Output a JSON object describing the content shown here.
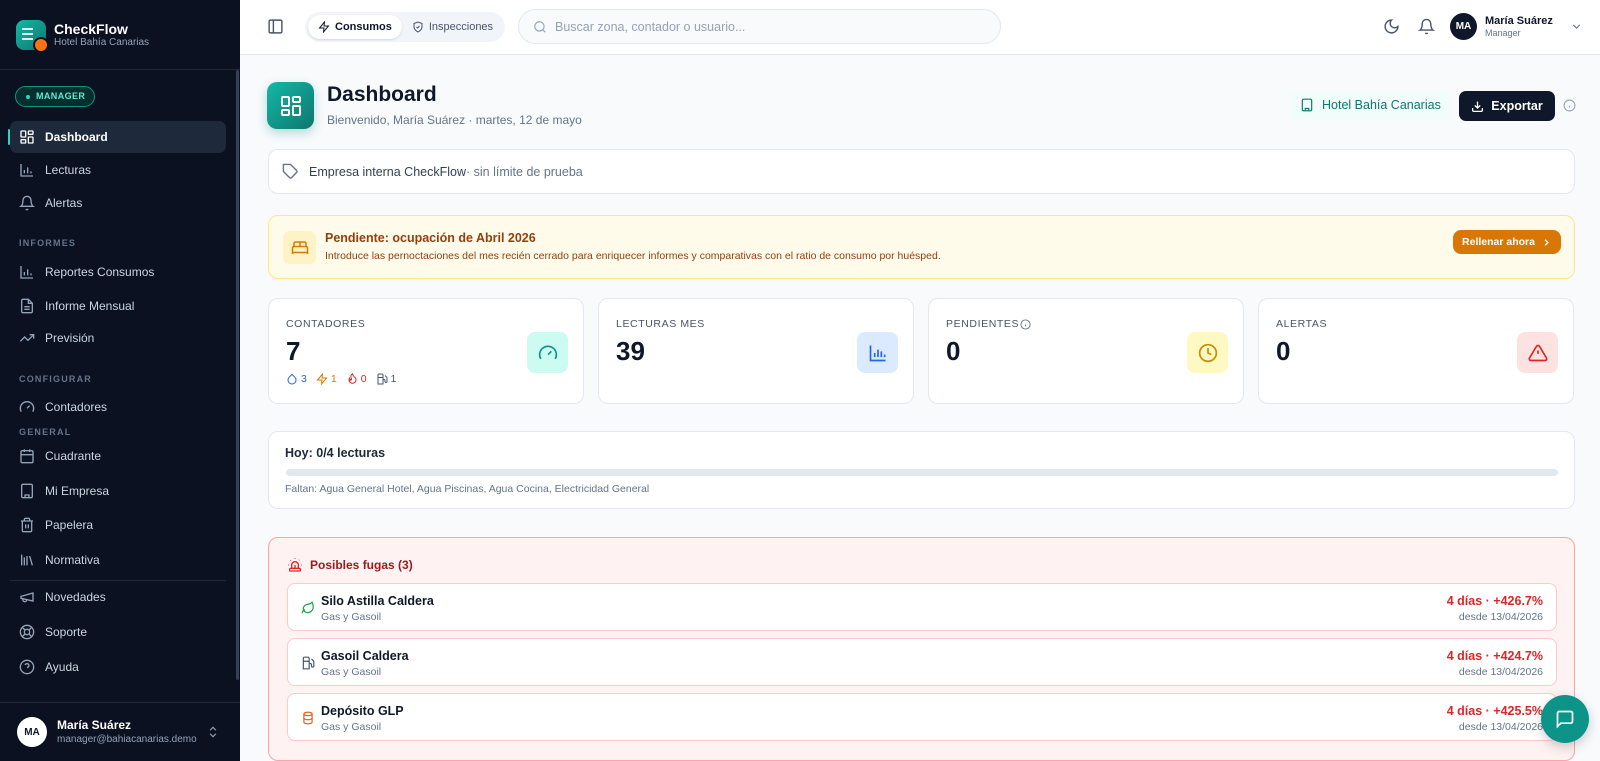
{
  "brand": {
    "name": "CheckFlow",
    "subtitle": "Hotel Bahía Canarias"
  },
  "sidebar": {
    "role_badge": "MANAGER",
    "main_items": [
      {
        "label": "Dashboard",
        "icon": "dashboard-icon",
        "active": true
      },
      {
        "label": "Lecturas",
        "icon": "chart-icon"
      },
      {
        "label": "Alertas",
        "icon": "bell-icon"
      }
    ],
    "sections": {
      "informes": "INFORMES",
      "configurar": "CONFIGURAR",
      "general": "GENERAL"
    },
    "informes_items": [
      {
        "label": "Reportes Consumos",
        "icon": "chart-icon"
      },
      {
        "label": "Informe Mensual",
        "icon": "document-icon"
      },
      {
        "label": "Previsión",
        "icon": "trend-icon"
      }
    ],
    "configurar_items": [
      {
        "label": "Contadores",
        "icon": "gauge-icon"
      }
    ],
    "general_items": [
      {
        "label": "Cuadrante",
        "icon": "calendar-icon"
      },
      {
        "label": "Mi Empresa",
        "icon": "building-icon"
      },
      {
        "label": "Papelera",
        "icon": "trash-icon"
      },
      {
        "label": "Normativa",
        "icon": "library-icon"
      }
    ],
    "bottom_items": [
      {
        "label": "Novedades",
        "icon": "megaphone-icon"
      },
      {
        "label": "Soporte",
        "icon": "lifebuoy-icon"
      },
      {
        "label": "Ayuda",
        "icon": "help-icon"
      }
    ],
    "user": {
      "initials": "MA",
      "name": "María Suárez",
      "email": "manager@bahiacanarias.demo"
    }
  },
  "topbar": {
    "tabs": [
      {
        "label": "Consumos",
        "icon": "bolt-icon",
        "active": true
      },
      {
        "label": "Inspecciones",
        "icon": "shield-icon"
      }
    ],
    "search_placeholder": "Buscar zona, contador o usuario...",
    "user": {
      "initials": "MA",
      "name": "María Suárez",
      "role": "Manager"
    }
  },
  "header": {
    "title": "Dashboard",
    "subtitle": "Bienvenido, María Suárez · martes, 12 de mayo",
    "hotel": "Hotel Bahía Canarias",
    "export_label": "Exportar"
  },
  "company": {
    "name": "Empresa interna CheckFlow",
    "note": " · sin límite de prueba"
  },
  "pending": {
    "title": "Pendiente: ocupación de Abril 2026",
    "text": "Introduce las pernoctaciones del mes recién cerrado para enriquecer informes y comparativas con el ratio de consumo por huésped.",
    "button": "Rellenar ahora"
  },
  "stats": [
    {
      "label": "CONTADORES",
      "value": "7",
      "icon": "gauge-icon"
    },
    {
      "label": "LECTURAS MES",
      "value": "39",
      "icon": "bar-chart-icon"
    },
    {
      "label": "PENDIENTES",
      "value": "0",
      "icon": "clock-icon"
    },
    {
      "label": "ALERTAS",
      "value": "0",
      "icon": "warning-icon"
    }
  ],
  "meter_breakdown": [
    {
      "icon": "water-drop-icon",
      "count": "3",
      "color": "#2563eb"
    },
    {
      "icon": "bolt-icon",
      "count": "1",
      "color": "#d97706"
    },
    {
      "icon": "flame-icon",
      "count": "0",
      "color": "#dc2626"
    },
    {
      "icon": "fuel-icon",
      "count": "1",
      "color": "#475569"
    }
  ],
  "colors": {
    "accent": "#14b8a6",
    "sidebar": "#0b1120",
    "danger": "#dc2626",
    "warning": "#d97706"
  },
  "today": {
    "title": "Hoy: 0/4 lecturas",
    "progress": 0,
    "missing": "Faltan: Agua General Hotel, Agua Piscinas, Agua Cocina, Electricidad General"
  },
  "leaks": {
    "title": "Posibles fugas (3)",
    "items": [
      {
        "name": "Silo Astilla Caldera",
        "category": "Gas y Gasoil",
        "delta": "4 días · +426.7%",
        "since": "desde 13/04/2026",
        "icon": "leaf-icon"
      },
      {
        "name": "Gasoil Caldera",
        "category": "Gas y Gasoil",
        "delta": "4 días · +424.7%",
        "since": "desde 13/04/2026",
        "icon": "fuel-icon"
      },
      {
        "name": "Depósito GLP",
        "category": "Gas y Gasoil",
        "delta": "4 días · +425.5%",
        "since": "desde 13/04/2026",
        "icon": "cylinder-icon"
      }
    ]
  }
}
